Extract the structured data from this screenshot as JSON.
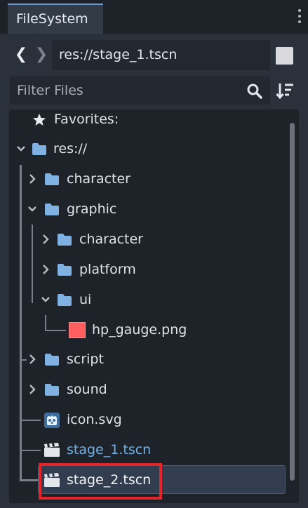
{
  "panel": {
    "tab_title": "FileSystem",
    "back_arrow": "❮",
    "forward_arrow": "❯",
    "path_value": "res://stage_1.tscn",
    "filter_placeholder": "Filter Files"
  },
  "colors": {
    "accent": "#6f98d8",
    "folder": "#7fb1e2",
    "current_file": "#73b2e8",
    "highlight_box": "#e3262c",
    "image_file": "#ff5f5f"
  },
  "tree": {
    "favorites_label": "Favorites:",
    "root_label": "res://",
    "items": [
      {
        "label": "character",
        "kind": "folder",
        "state": "collapsed"
      },
      {
        "label": "graphic",
        "kind": "folder",
        "state": "expanded"
      },
      {
        "label": "character",
        "kind": "folder",
        "state": "collapsed"
      },
      {
        "label": "platform",
        "kind": "folder",
        "state": "collapsed"
      },
      {
        "label": "ui",
        "kind": "folder",
        "state": "expanded"
      },
      {
        "label": "hp_gauge.png",
        "kind": "image"
      },
      {
        "label": "script",
        "kind": "folder",
        "state": "collapsed"
      },
      {
        "label": "sound",
        "kind": "folder",
        "state": "collapsed"
      },
      {
        "label": "icon.svg",
        "kind": "svg"
      },
      {
        "label": "stage_1.tscn",
        "kind": "scene",
        "current": true
      },
      {
        "label": "stage_2.tscn",
        "kind": "scene",
        "selected": true
      }
    ]
  }
}
